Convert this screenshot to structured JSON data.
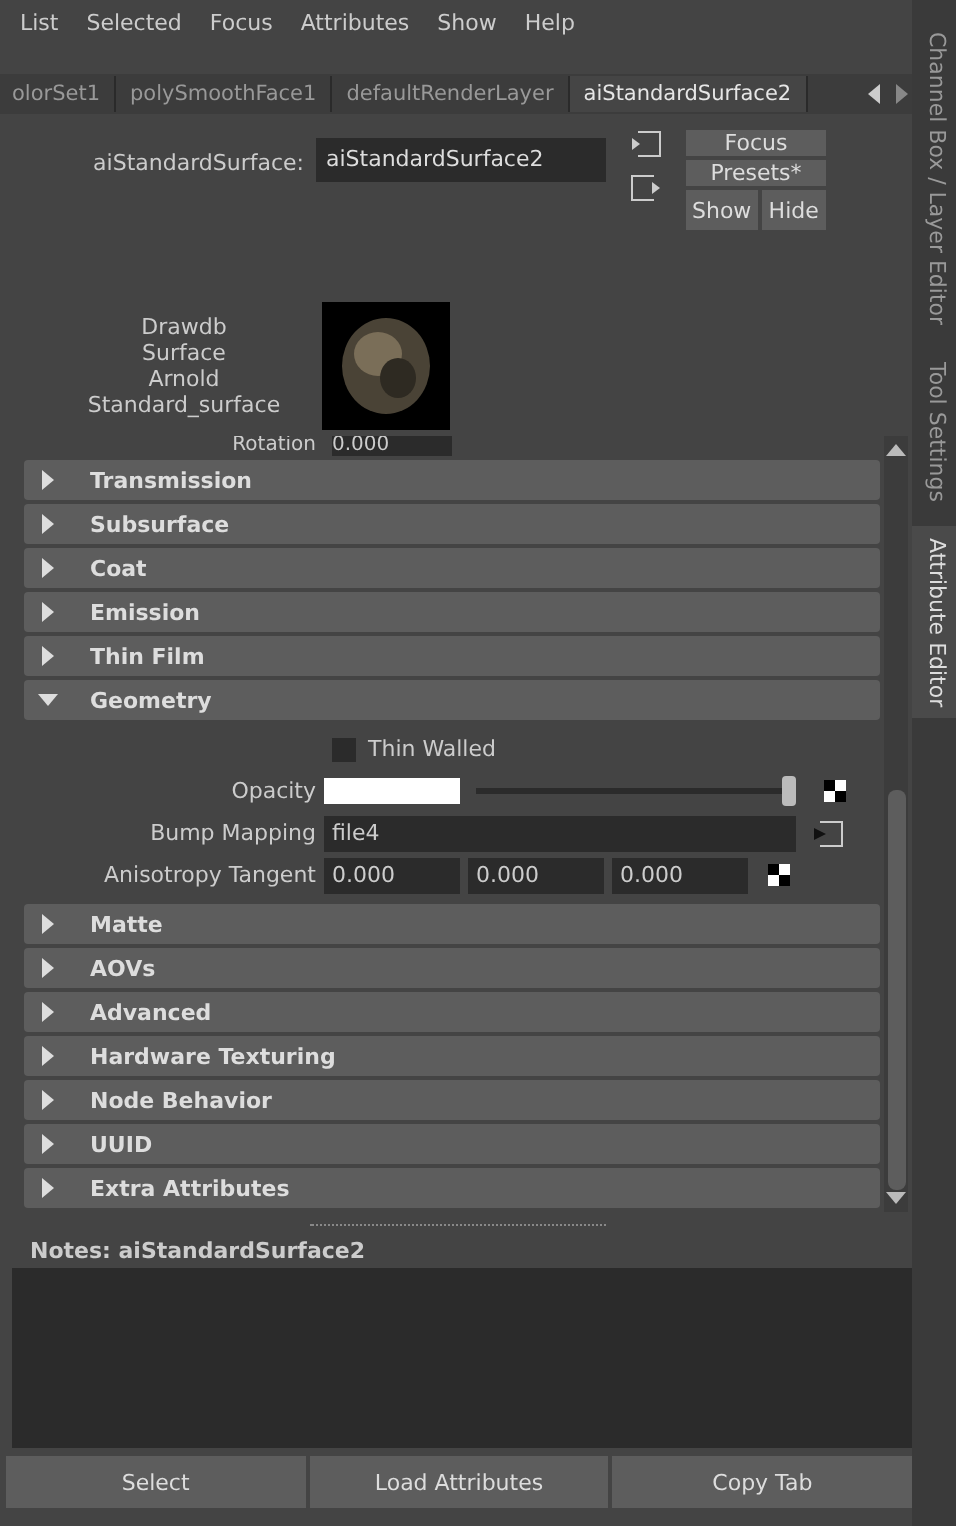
{
  "menu": [
    "List",
    "Selected",
    "Focus",
    "Attributes",
    "Show",
    "Help"
  ],
  "tabs": [
    {
      "label": "olorSet1",
      "selected": false
    },
    {
      "label": "polySmoothFace1",
      "selected": false
    },
    {
      "label": "defaultRenderLayer",
      "selected": false
    },
    {
      "label": "aiStandardSurface2",
      "selected": true
    }
  ],
  "node": {
    "label": "aiStandardSurface:",
    "value": "aiStandardSurface2"
  },
  "buttons": [
    "Focus",
    "Presets*",
    "Show",
    "Hide"
  ],
  "swatch_caption": [
    "Drawdb",
    "Surface",
    "Arnold",
    "Standard_surface"
  ],
  "partial_row": {
    "label": "Rotation",
    "value": "0.000"
  },
  "sections": [
    {
      "title": "Transmission",
      "expanded": false
    },
    {
      "title": "Subsurface",
      "expanded": false
    },
    {
      "title": "Coat",
      "expanded": false
    },
    {
      "title": "Emission",
      "expanded": false
    },
    {
      "title": "Thin Film",
      "expanded": false
    },
    {
      "title": "Geometry",
      "expanded": true,
      "attributes": [
        {
          "kind": "checkbox",
          "label": "Thin Walled",
          "checked": false
        },
        {
          "kind": "slider",
          "label": "Opacity",
          "level": 1
        },
        {
          "kind": "texture",
          "label": "Bump Mapping",
          "value": "file4"
        },
        {
          "kind": "vector",
          "label": "Anisotropy Tangent",
          "values": [
            "0.000",
            "0.000",
            "0.000"
          ]
        }
      ]
    },
    {
      "title": "Matte",
      "expanded": false
    },
    {
      "title": "AOVs",
      "expanded": false
    },
    {
      "title": "Advanced",
      "expanded": false
    },
    {
      "title": "Hardware Texturing",
      "expanded": false
    },
    {
      "title": "Node Behavior",
      "expanded": false
    },
    {
      "title": "UUID",
      "expanded": false
    },
    {
      "title": "Extra Attributes",
      "expanded": false
    }
  ],
  "notes": {
    "label": "Notes:  aiStandardSurface2"
  },
  "bottom_buttons": [
    "Select",
    "Load Attributes",
    "Copy Tab"
  ],
  "side_tabs": [
    {
      "label": "Channel Box / Layer Editor",
      "selected": false
    },
    {
      "label": "Tool Settings",
      "selected": false
    },
    {
      "label": "Attribute Editor",
      "selected": true
    }
  ]
}
